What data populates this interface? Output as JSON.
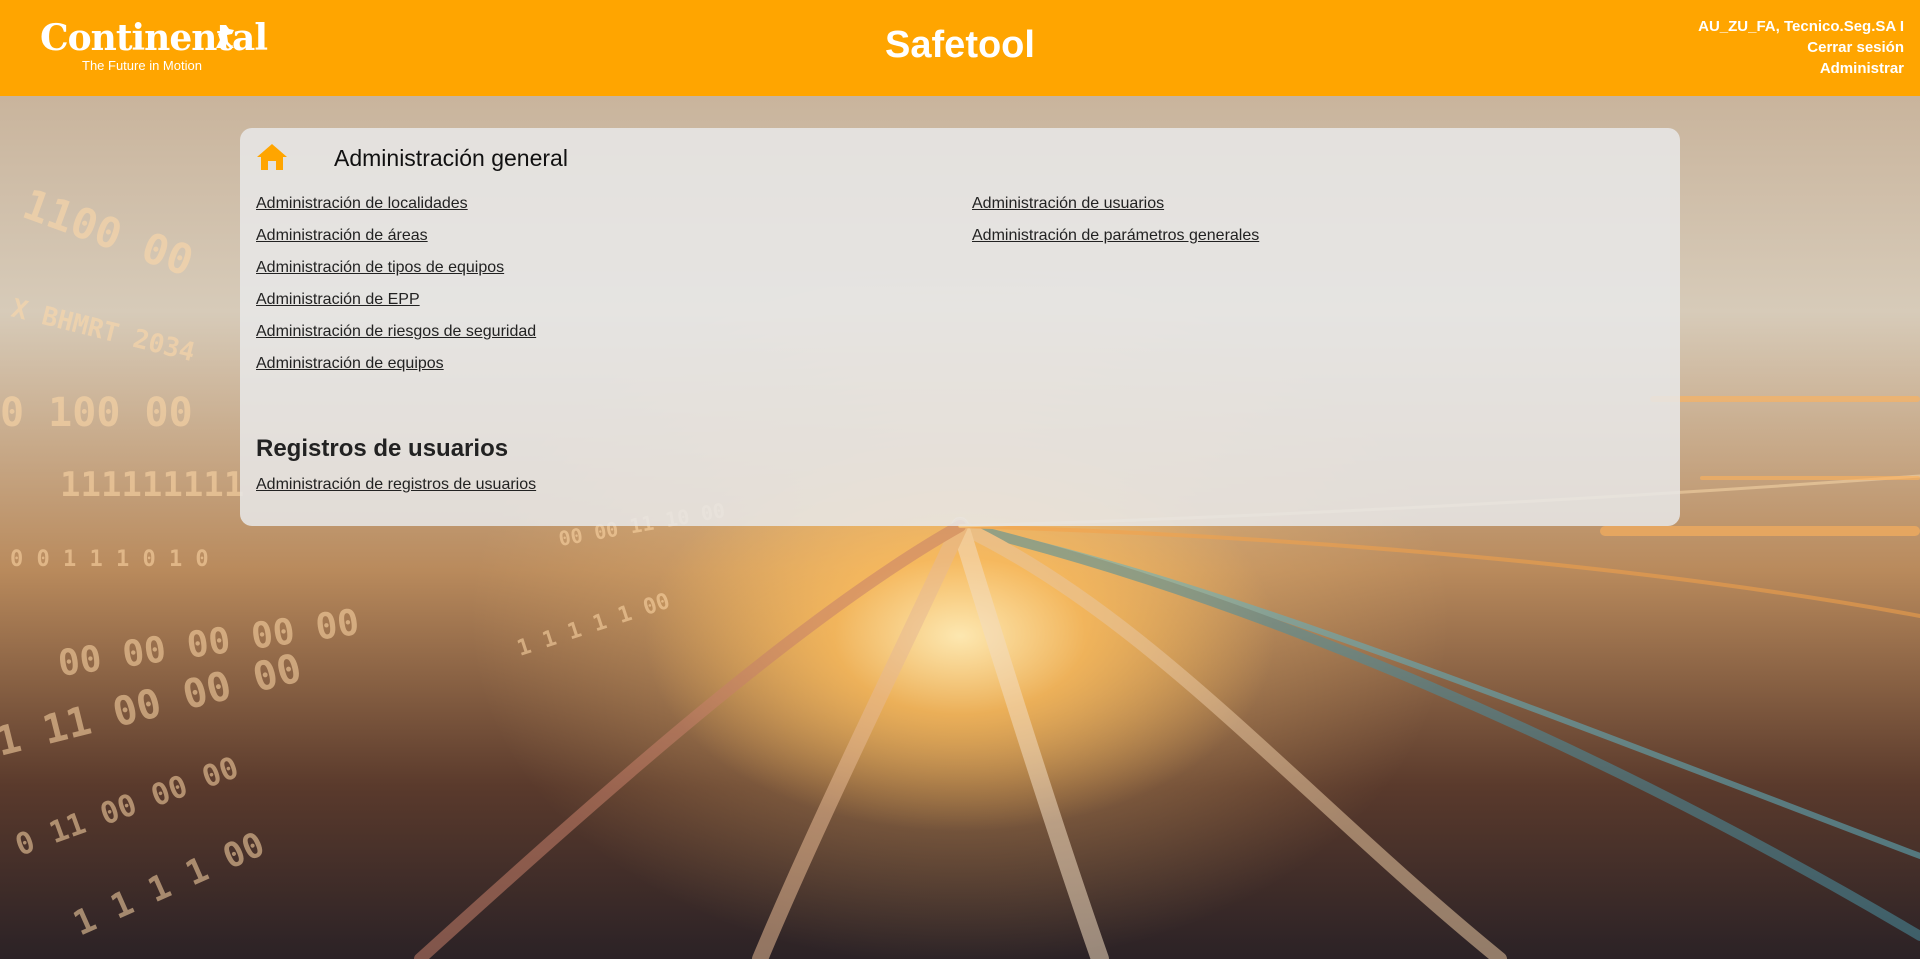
{
  "header": {
    "logo_word": "Continental",
    "logo_tagline": "The Future in Motion",
    "app_title": "Safetool",
    "user_name": "AU_ZU_FA, Tecnico.Seg.SA I",
    "logout_label": "Cerrar sesión",
    "admin_label": "Administrar",
    "accent_color": "#ffa500"
  },
  "admin": {
    "home_icon": "home-icon",
    "title": "Administración general",
    "left_links": [
      "Administración de localidades",
      "Administración de áreas",
      "Administración de tipos de equipos",
      "Administración de EPP",
      "Administración de riesgos de seguridad",
      "Administración de equipos"
    ],
    "right_links": [
      "Administración de usuarios",
      "Administración de parámetros generales"
    ]
  },
  "registros": {
    "title": "Registros de usuarios",
    "link": "Administración de registros de usuarios"
  }
}
